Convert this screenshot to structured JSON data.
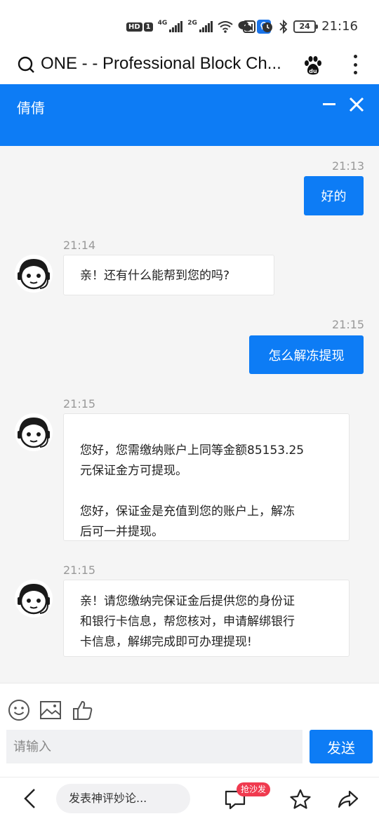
{
  "status_bar": {
    "badge_hd": "HD",
    "badge_1": "1",
    "net1": "4G",
    "net2": "2G",
    "battery": "24",
    "time": "21:16"
  },
  "browser": {
    "title": "ONE - - Professional Block Ch...",
    "icons": [
      "search-icon",
      "baidu-icon",
      "more-icon"
    ]
  },
  "chat": {
    "title": "倩倩",
    "messages": [
      {
        "side": "out",
        "time": "21:13",
        "text": "好的"
      },
      {
        "side": "in",
        "time": "21:14",
        "text": "亲！还有什么能帮到您的吗?"
      },
      {
        "side": "out",
        "time": "21:15",
        "text": "怎么解冻提现"
      },
      {
        "side": "in",
        "time": "21:15",
        "lines": [
          "您好，您需缴纳账户上同等金额85153.25",
          "元保证金方可提现。",
          "您好，保证金是充值到您的账户上，解冻",
          "后可一并提现。"
        ]
      },
      {
        "side": "in",
        "time": "21:15",
        "lines": [
          "亲！请您缴纳完保证金后提供您的身份证",
          "和银行卡信息，帮您核对，申请解绑银行",
          "卡信息，解绑完成即可办理提现!"
        ]
      }
    ]
  },
  "composer": {
    "placeholder": "请输入",
    "send_label": "发送"
  },
  "bottom_nav": {
    "comment_placeholder": "发表神评妙论...",
    "hot_badge": "抢沙发"
  },
  "colors": {
    "accent": "#0d7cf5",
    "badge_red": "#f03a4f"
  }
}
